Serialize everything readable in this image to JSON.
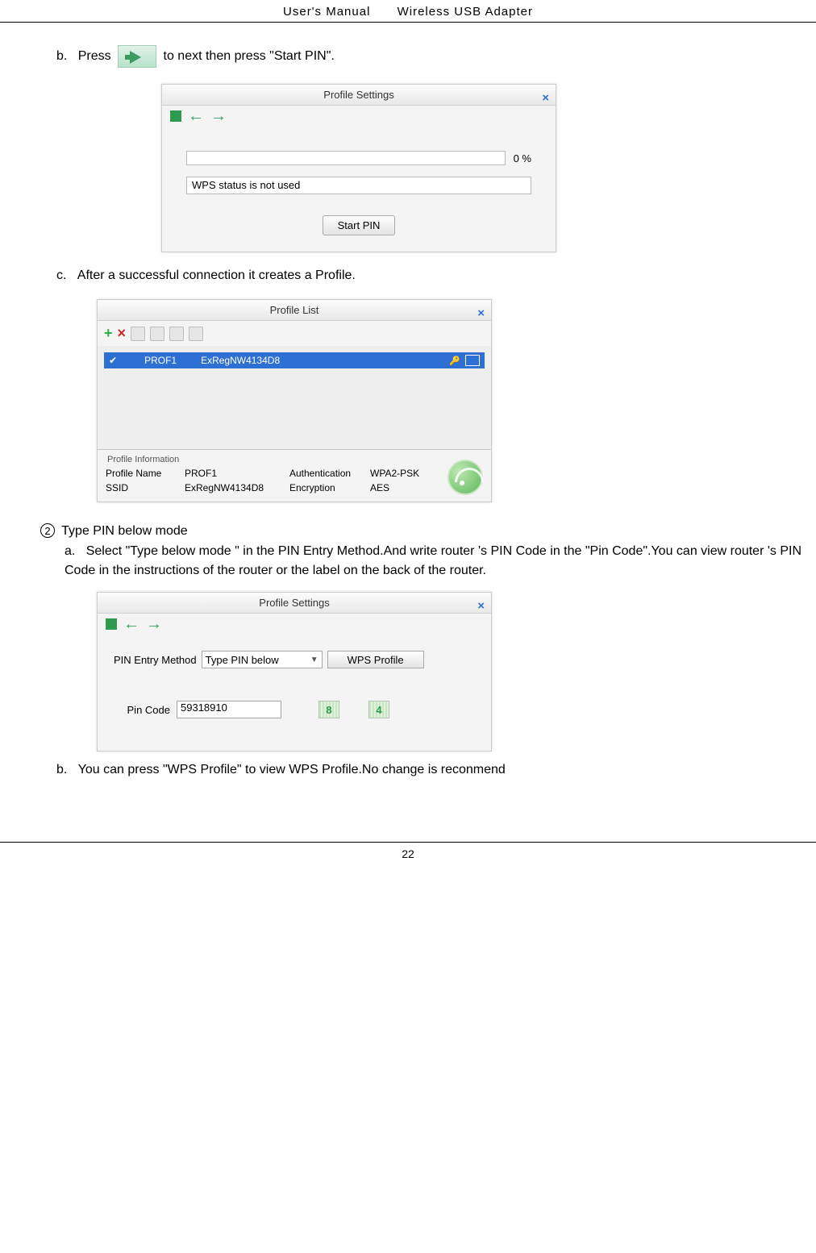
{
  "header": {
    "left": "User's Manual",
    "right": "Wireless USB Adapter"
  },
  "step_b": {
    "label": "b.",
    "text_before": "Press",
    "text_after": "to next then press \"Start PIN\"."
  },
  "settings_window": {
    "title": "Profile Settings",
    "progress_label": "0 %",
    "status_text": "WPS status is not used",
    "start_button": "Start PIN"
  },
  "step_c": {
    "label": "c.",
    "text": "After a successful connection it creates a Profile."
  },
  "list_window": {
    "title": "Profile List",
    "row": {
      "name": "PROF1",
      "ssid": "ExRegNW4134D8"
    },
    "profile_info": {
      "legend": "Profile Information",
      "labels": {
        "profile_name": "Profile Name",
        "ssid": "SSID",
        "auth": "Authentication",
        "enc": "Encryption"
      },
      "values": {
        "profile_name": "PROF1",
        "ssid": "ExRegNW4134D8",
        "auth": "WPA2-PSK",
        "enc": "AES"
      }
    }
  },
  "section2": {
    "num": "2",
    "heading": "Type PIN below mode",
    "sub_a_label": "a.",
    "sub_a_text": "Select \"Type below mode \" in the PIN Entry Method.And write router 's PIN Code in the \"Pin Code\".You can view router 's PIN Code in the instructions of the router or the label on the back of the router."
  },
  "settings2_window": {
    "title": "Profile Settings",
    "method_label": "PIN Entry Method",
    "method_value": "Type PIN below",
    "wps_button": "WPS Profile",
    "pin_label": "Pin Code",
    "pin_value": "59318910",
    "green1": "8",
    "green2": "4"
  },
  "step_b2": {
    "label": "b.",
    "text": "You can press \"WPS Profile\" to view WPS Profile.No change is reconmend"
  },
  "page_number": "22"
}
